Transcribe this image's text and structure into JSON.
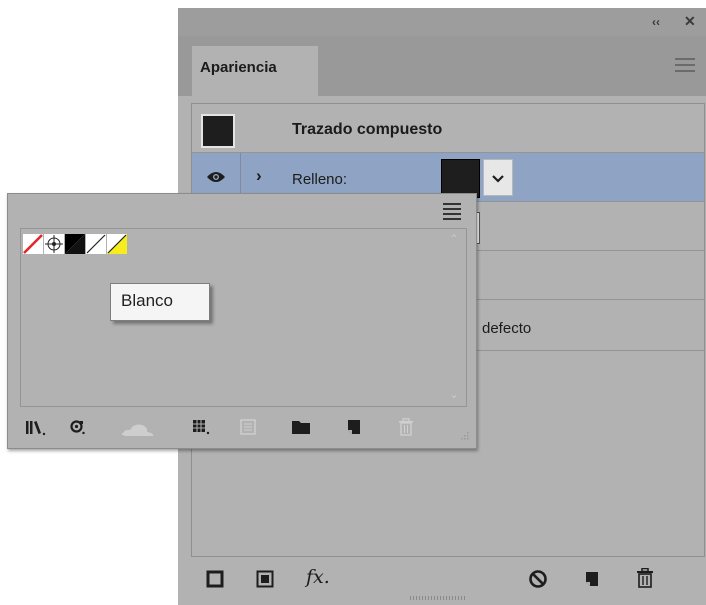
{
  "appearance_panel": {
    "title_bar": {
      "collapse_icon": "double-chevron-left-icon",
      "close_icon": "close-icon"
    },
    "tab": {
      "label": "Apariencia"
    },
    "panel_menu_icon": "hamburger-menu-icon",
    "object_title": "Trazado compuesto",
    "fill_row": {
      "label": "Relleno:",
      "color": "#1e1e1e",
      "selected_bg": "#8fa4c4"
    },
    "partial_text": "defecto",
    "footer_icons": [
      "add-new-stroke-icon",
      "add-new-fill-icon",
      "fx-icon",
      "clear-appearance-icon",
      "duplicate-item-icon",
      "delete-item-icon"
    ],
    "fx_label": "fx"
  },
  "swatches_panel": {
    "menu_icon": "list-menu-icon",
    "swatches": [
      {
        "name": "None",
        "color": "#ffffff"
      },
      {
        "name": "Registration",
        "color": "#ffffff"
      },
      {
        "name": "Black",
        "color": "#000000"
      },
      {
        "name": "White",
        "color": "#ffffff"
      },
      {
        "name": "Yellow",
        "color": "#f7ec1e"
      }
    ],
    "tooltip": "Blanco",
    "footer_icons": [
      "swatch-libraries-icon",
      "show-kinds-icon",
      "cloud-sync-icon",
      "swatch-options-grid-icon",
      "color-group-icon",
      "new-folder-icon",
      "new-swatch-icon",
      "delete-swatch-icon"
    ]
  }
}
